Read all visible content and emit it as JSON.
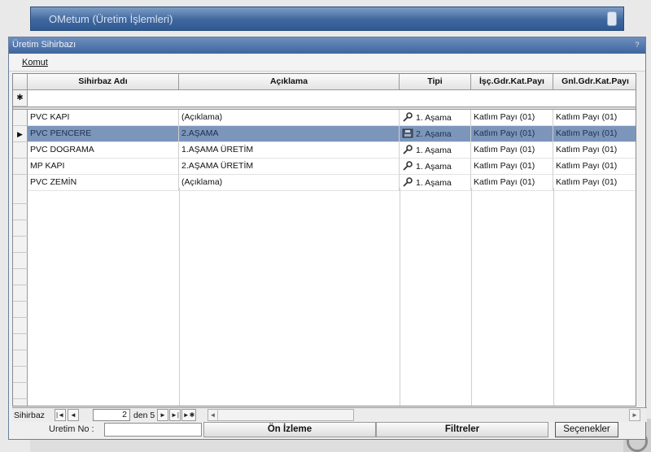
{
  "parent_window": {
    "title": "OMetum (Üretim İşlemleri)"
  },
  "window": {
    "title": "Üretim Sihirbazı",
    "close_glyph": "?"
  },
  "menu": {
    "komut": "Komut"
  },
  "grid": {
    "columns": [
      "Sihirbaz Adı",
      "Açıklama",
      "Tipi",
      "İşç.Gdr.Kat.Payı",
      "Gnl.Gdr.Kat.Payı"
    ],
    "new_row_marker": "✱",
    "rows": [
      {
        "name": "PVC KAPI",
        "desc": "(Açıklama)",
        "type": "1. Aşama",
        "isc": "Katlım Payı (01)",
        "gnl": "Katlım Payı (01)",
        "icon": "pin-icon",
        "selected": false
      },
      {
        "name": "PVC PENCERE",
        "desc": "2.AŞAMA",
        "type": "2. Aşama",
        "isc": "Katlım Payı (01)",
        "gnl": "Katlım Payı (01)",
        "icon": "disk-icon",
        "selected": true
      },
      {
        "name": "PVC DOGRAMA",
        "desc": "1.AŞAMA ÜRETİM",
        "type": "1. Aşama",
        "isc": "Katlım Payı (01)",
        "gnl": "Katlım Payı (01)",
        "icon": "pin-icon",
        "selected": false
      },
      {
        "name": "MP KAPI",
        "desc": "2.AŞAMA ÜRETİM",
        "type": "1. Aşama",
        "isc": "Katlım Payı (01)",
        "gnl": "Katlım Payı (01)",
        "icon": "pin-icon",
        "selected": false
      },
      {
        "name": "PVC ZEMİN",
        "desc": "(Açıklama)",
        "type": "1. Aşama",
        "isc": "Katlım Payı (01)",
        "gnl": "Katlım Payı (01)",
        "icon": "pin-icon",
        "selected": false
      }
    ]
  },
  "navigator": {
    "label": "Sihirbaz",
    "current": "2",
    "of_text": "den 5",
    "buttons": {
      "first": "|◄",
      "prev": "◄",
      "next": "►",
      "last": "►|",
      "new": "►✱"
    }
  },
  "footer": {
    "uretim_label": "Uretim No :",
    "uretim_value": "",
    "on_izleme": "Ön İzleme",
    "filtreler": "Filtreler",
    "secenekler": "Seçenekler"
  }
}
